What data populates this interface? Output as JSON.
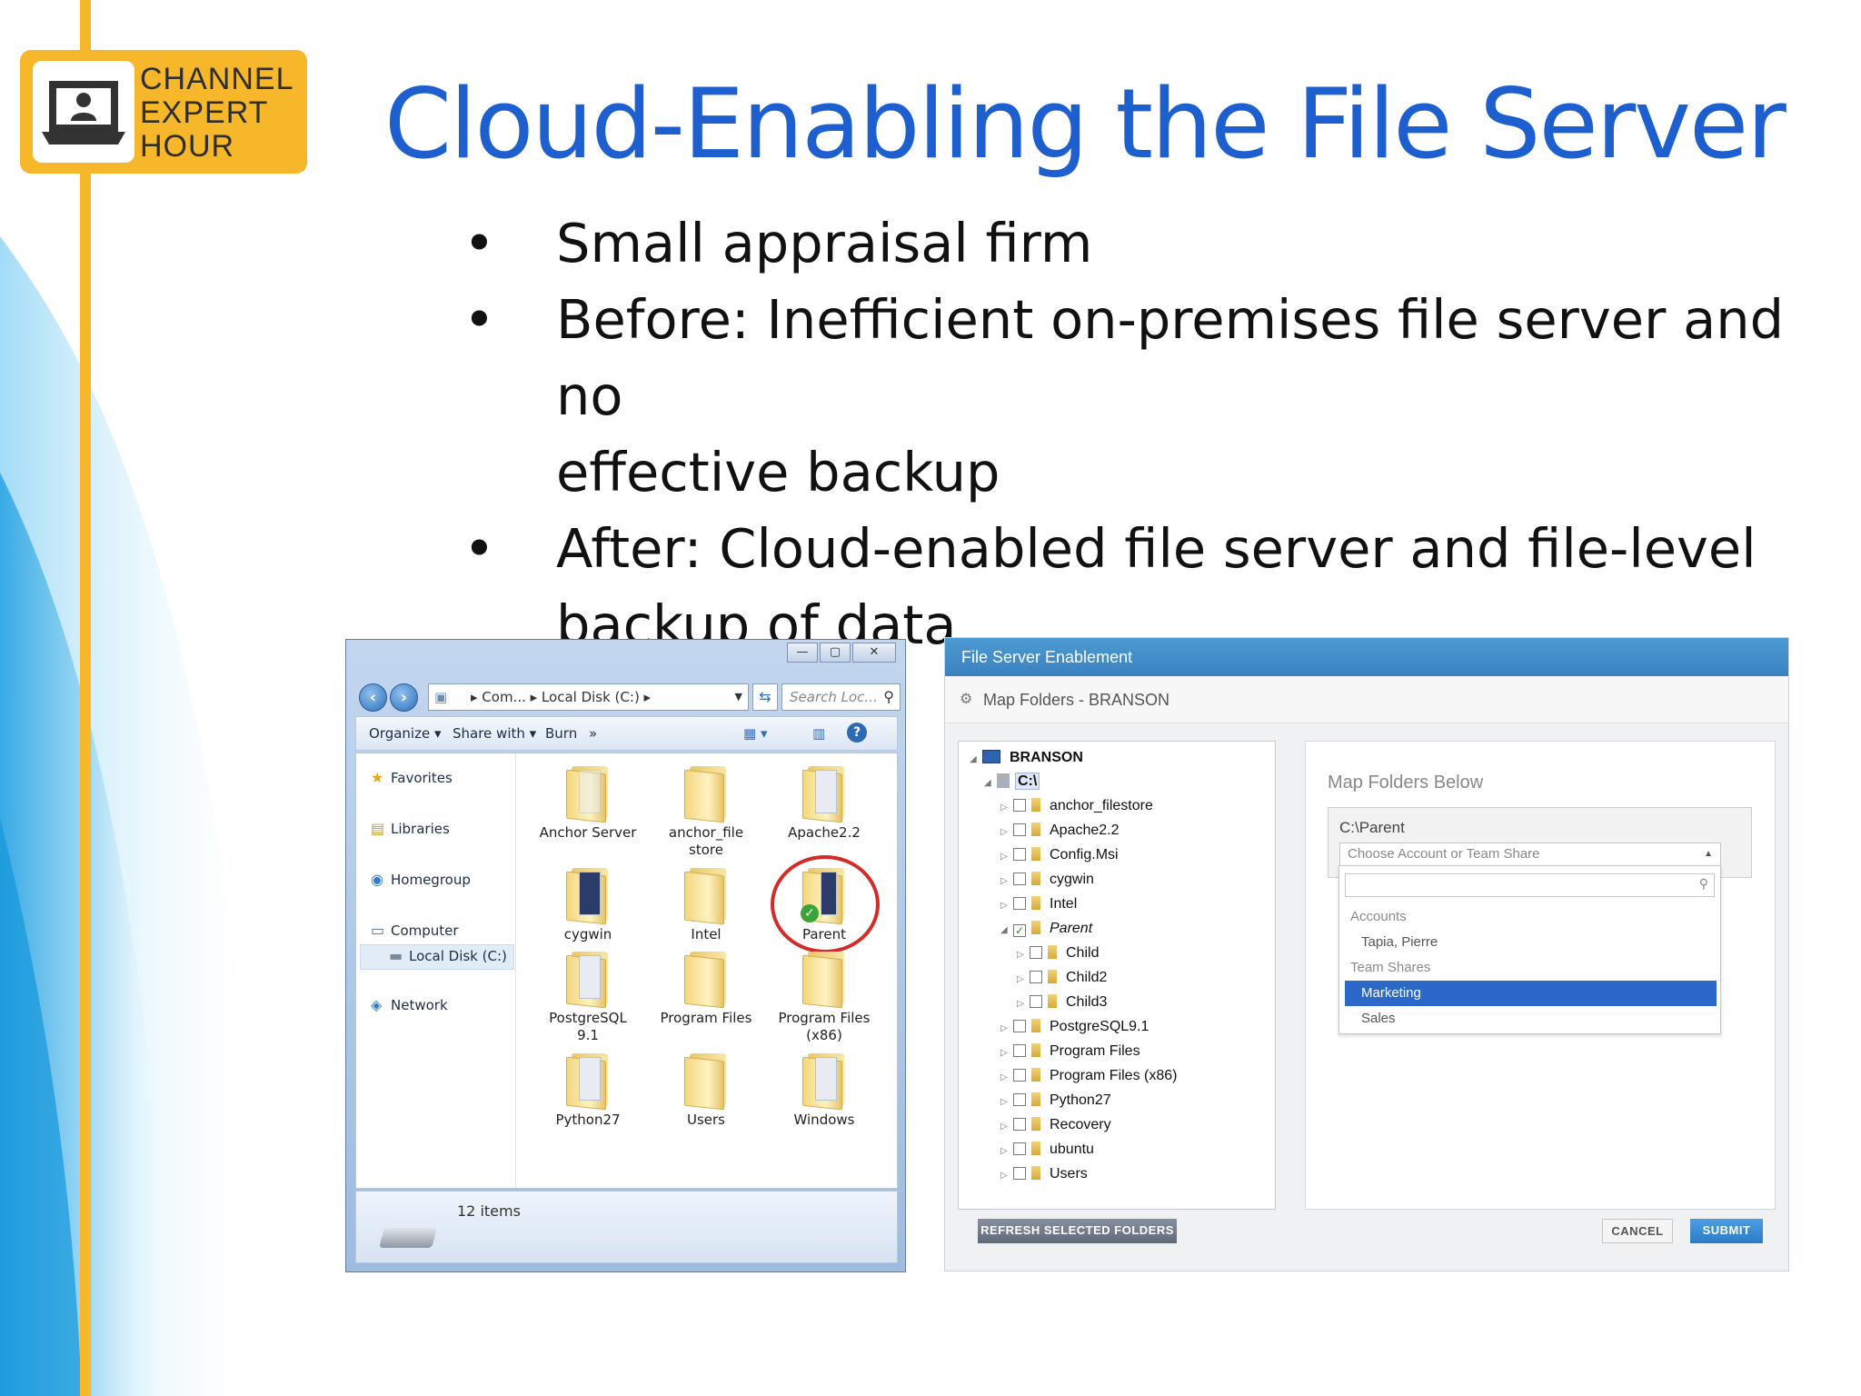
{
  "slide": {
    "logo_lines": [
      "CHANNEL",
      "EXPERT",
      "HOUR"
    ],
    "title": "Cloud-Enabling the File Server",
    "bullets": [
      {
        "lines": [
          "Small appraisal firm"
        ]
      },
      {
        "lines": [
          "Before: Inefficient on-premises file server and no",
          "effective backup"
        ]
      },
      {
        "lines": [
          "After: Cloud-enabled file server and file-level",
          "backup of data"
        ]
      }
    ],
    "colors": {
      "title": "#1e5fcf",
      "logo": "#f6b82a",
      "stripe": "#f6b82a"
    }
  },
  "explorer": {
    "window_controls": [
      "—",
      "▢",
      "✕"
    ],
    "nav_back_icon": "back-arrow-icon",
    "nav_forward_icon": "forward-arrow-icon",
    "address": "▸ Com...  ▸ Local Disk (C:)  ▸",
    "search_placeholder": "Search Loc...",
    "toolbar": {
      "organize": "Organize ▾",
      "share_with": "Share with ▾",
      "burn": "Burn",
      "more": "»"
    },
    "nav_pane": [
      {
        "label": "Favorites",
        "icon": "★"
      },
      {
        "label": "Libraries",
        "icon": "▤"
      },
      {
        "label": "Homegroup",
        "icon": "◉"
      },
      {
        "label": "Computer",
        "icon": "▭"
      },
      {
        "label": "Local Disk (C:)",
        "icon": "▬"
      },
      {
        "label": "Network",
        "icon": "◈"
      }
    ],
    "folders": [
      {
        "label": "Anchor Server"
      },
      {
        "label": "anchor_file store"
      },
      {
        "label": "Apache2.2"
      },
      {
        "label": "cygwin"
      },
      {
        "label": "Intel"
      },
      {
        "label": "Parent"
      },
      {
        "label": "PostgreSQL 9.1"
      },
      {
        "label": "Program Files"
      },
      {
        "label": "Program Files (x86)"
      },
      {
        "label": "Python27"
      },
      {
        "label": "Users"
      },
      {
        "label": "Windows"
      }
    ],
    "status": "12 items"
  },
  "webapp": {
    "header": "File Server Enablement",
    "map_title": "Map Folders - BRANSON",
    "tree": [
      {
        "label": "BRANSON",
        "checked": false
      },
      {
        "label": "C:\\",
        "checked": false
      },
      {
        "label": "anchor_filestore",
        "checked": false
      },
      {
        "label": "Apache2.2",
        "checked": false
      },
      {
        "label": "Config.Msi",
        "checked": false
      },
      {
        "label": "cygwin",
        "checked": false
      },
      {
        "label": "Intel",
        "checked": false
      },
      {
        "label": "Parent",
        "checked": true
      },
      {
        "label": "Child",
        "checked": false
      },
      {
        "label": "Child2",
        "checked": false
      },
      {
        "label": "Child3",
        "checked": false
      },
      {
        "label": "PostgreSQL9.1",
        "checked": false
      },
      {
        "label": "Program Files",
        "checked": false
      },
      {
        "label": "Program Files (x86)",
        "checked": false
      },
      {
        "label": "Python27",
        "checked": false
      },
      {
        "label": "Recovery",
        "checked": false
      },
      {
        "label": "ubuntu",
        "checked": false
      },
      {
        "label": "Users",
        "checked": false
      }
    ],
    "map_below": "Map Folders Below",
    "mapped_path": "C:\\Parent",
    "combo_placeholder": "Choose Account or Team Share",
    "dropdown": {
      "accounts_header": "Accounts",
      "account": "Tapia, Pierre",
      "team_header": "Team Shares",
      "team_selected": "Marketing",
      "team_other": "Sales"
    },
    "refresh_button": "REFRESH SELECTED FOLDERS",
    "cancel_button": "CANCEL",
    "submit_button": "SUBMIT",
    "colors": {
      "header": "#3a82bf",
      "selected": "#2c68c7"
    }
  }
}
